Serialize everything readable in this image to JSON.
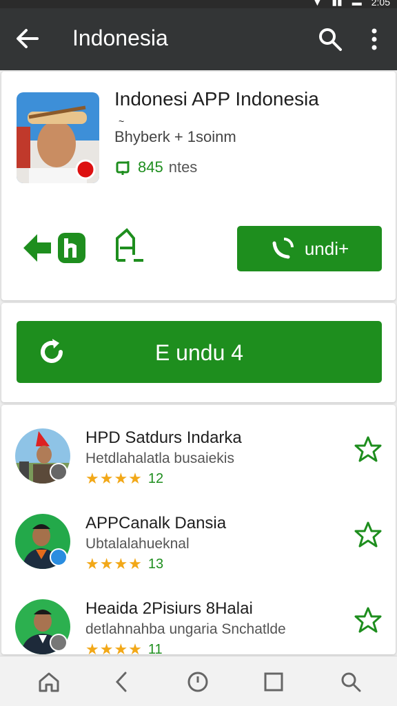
{
  "status_bar": {
    "time": "2:05"
  },
  "app_bar": {
    "title": "Indonesia"
  },
  "app": {
    "name": "Indonesi APP Indonesia",
    "developer_deco": "~",
    "developer": "Bhyberk + 1soinm",
    "installs_count": "845",
    "installs_unit": "ntes",
    "action_button_label": "undi+"
  },
  "main_button": {
    "label": "E undu 4"
  },
  "list": [
    {
      "title": "HPD Satdurs Indarka",
      "subtitle": "Hetdlahalatla busaiekis",
      "stars": "★★★★",
      "count": "12",
      "rating": 4
    },
    {
      "title": "APPCanalk Dansia",
      "subtitle": "Ubtalalahueknal",
      "stars": "★★★★",
      "count": "13",
      "rating": 3.5
    },
    {
      "title": "Heaida 2Pisiurs 8Halai",
      "subtitle": "detlahnahba ungaria Snchatlde",
      "stars": "★★★★",
      "count": "11",
      "rating": 4
    }
  ],
  "colors": {
    "accent": "#1e8e1e",
    "appbar": "#333536",
    "star": "#f2a818"
  }
}
